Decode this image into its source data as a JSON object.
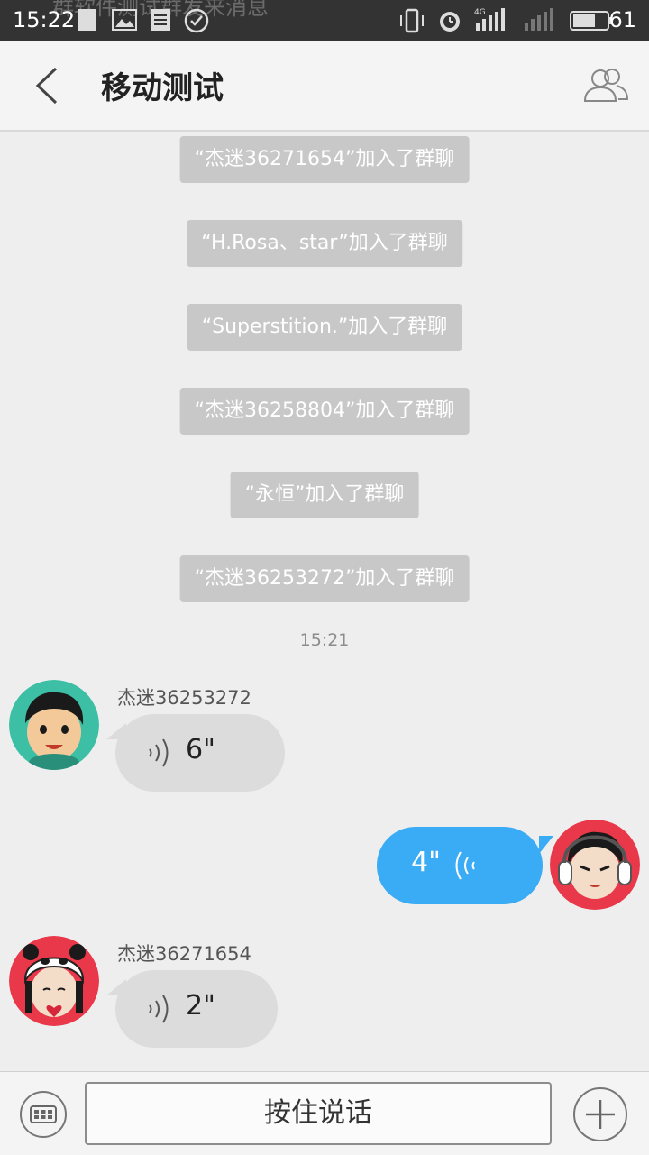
{
  "status_bar": {
    "time": "15:22",
    "ghost_text": "群软件测试群发来消息",
    "battery": "61",
    "network": "4G"
  },
  "header": {
    "back_icon": "chevron-left-icon",
    "title": "移动测试",
    "members_icon": "group-members-icon"
  },
  "notices": [
    "“杰迷36271654”加入了群聊",
    "“H.Rosa、star”加入了群聊",
    "“Superstition.”加入了群聊",
    "“杰迷36258804”加入了群聊",
    "“永恒”加入了群聊",
    "“杰迷36253272”加入了群聊"
  ],
  "time_separator": "15:21",
  "messages": [
    {
      "side": "left",
      "sender": "杰迷36253272",
      "type": "voice",
      "duration": "6\""
    },
    {
      "side": "right",
      "sender": "",
      "type": "voice",
      "duration": "4\""
    },
    {
      "side": "left",
      "sender": "杰迷36271654",
      "type": "voice",
      "duration": "2\""
    }
  ],
  "bottom_bar": {
    "keyboard_icon": "keyboard-icon",
    "voice_button_label": "按住说话",
    "plus_icon": "plus-icon"
  },
  "colors": {
    "status_bar": "#333333",
    "header_bg": "#f4f4f4",
    "chat_bg": "#eeeeee",
    "notice_bg": "#c8c8c8",
    "bubble_left": "#dcdcdc",
    "bubble_right": "#3aabf5"
  }
}
